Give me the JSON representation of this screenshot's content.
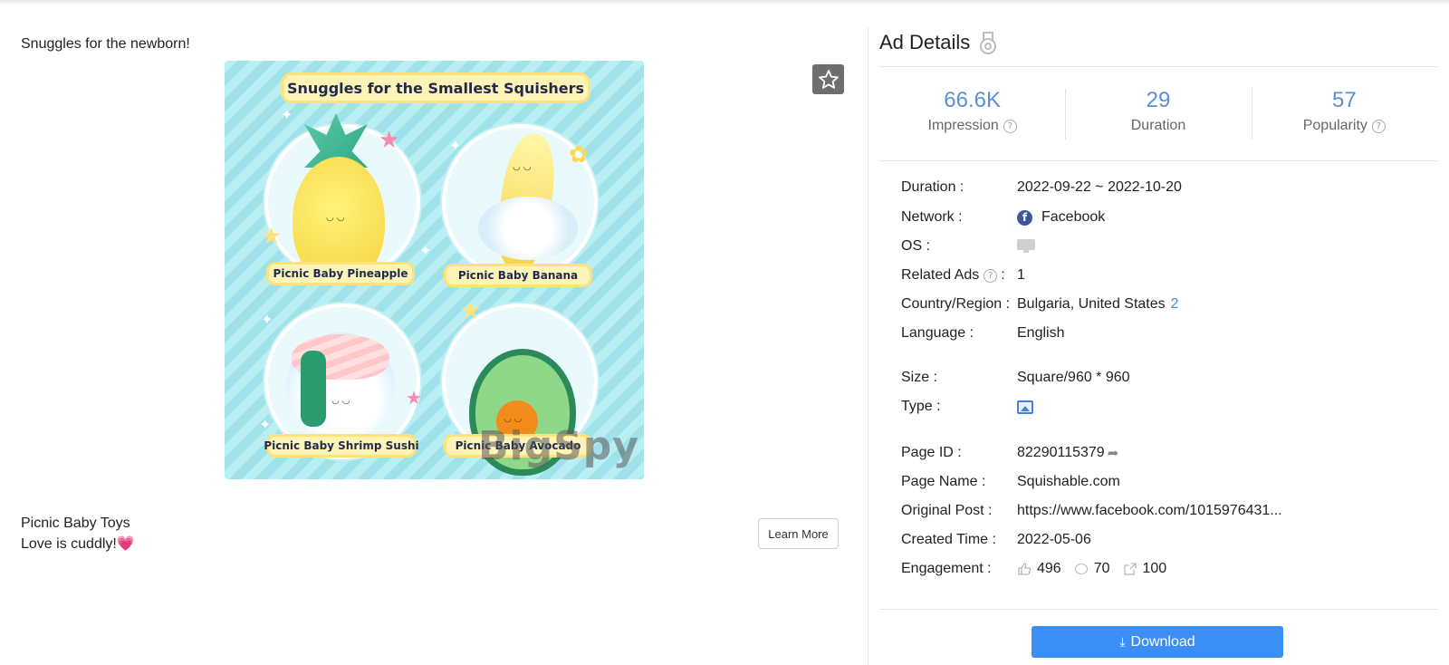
{
  "ad": {
    "caption": "Snuggles for the newborn!",
    "creative": {
      "headline": "Snuggles for the Smallest Squishers",
      "products": [
        "Picnic Baby Pineapple",
        "Picnic Baby Banana",
        "Picnic Baby Shrimp Sushi",
        "Picnic Baby Avocado"
      ],
      "watermark": "BigSpy"
    },
    "description_line1": "Picnic Baby Toys",
    "description_line2": "Love is cuddly!",
    "description_emoji": "💗",
    "cta_label": "Learn More",
    "favorite_icon": "star-icon"
  },
  "details": {
    "title": "Ad Details",
    "title_icon": "medal-icon",
    "stats": [
      {
        "value": "66.6K",
        "label": "Impression",
        "has_help": true
      },
      {
        "value": "29",
        "label": "Duration",
        "has_help": false
      },
      {
        "value": "57",
        "label": "Popularity",
        "has_help": true
      }
    ],
    "rows": {
      "duration": {
        "label": "Duration :",
        "value": "2022-09-22 ~ 2022-10-20"
      },
      "network": {
        "label": "Network :",
        "value": "Facebook",
        "icon": "facebook-icon"
      },
      "os": {
        "label": "OS :",
        "icon": "desktop-icon"
      },
      "related_ads": {
        "label": "Related Ads",
        "suffix": ":",
        "value": "1"
      },
      "country": {
        "label": "Country/Region :",
        "value": "Bulgaria, United States",
        "count": "2"
      },
      "language": {
        "label": "Language :",
        "value": "English"
      },
      "size": {
        "label": "Size :",
        "value": "Square/960 * 960"
      },
      "type": {
        "label": "Type :",
        "icon": "image-icon"
      },
      "page_id": {
        "label": "Page ID :",
        "value": "82290115379"
      },
      "page_name": {
        "label": "Page Name :",
        "value": "Squishable.com"
      },
      "original_post": {
        "label": "Original Post :",
        "value": "https://www.facebook.com/1015976431..."
      },
      "created_time": {
        "label": "Created Time :",
        "value": "2022-05-06"
      },
      "engagement": {
        "label": "Engagement :",
        "likes": "496",
        "comments": "70",
        "shares": "100"
      }
    },
    "download_label": "Download"
  },
  "colors": {
    "accent": "#3a8ef6",
    "stat_value": "#5b8fd6",
    "link": "#3a8be8",
    "facebook": "#3b5998"
  }
}
